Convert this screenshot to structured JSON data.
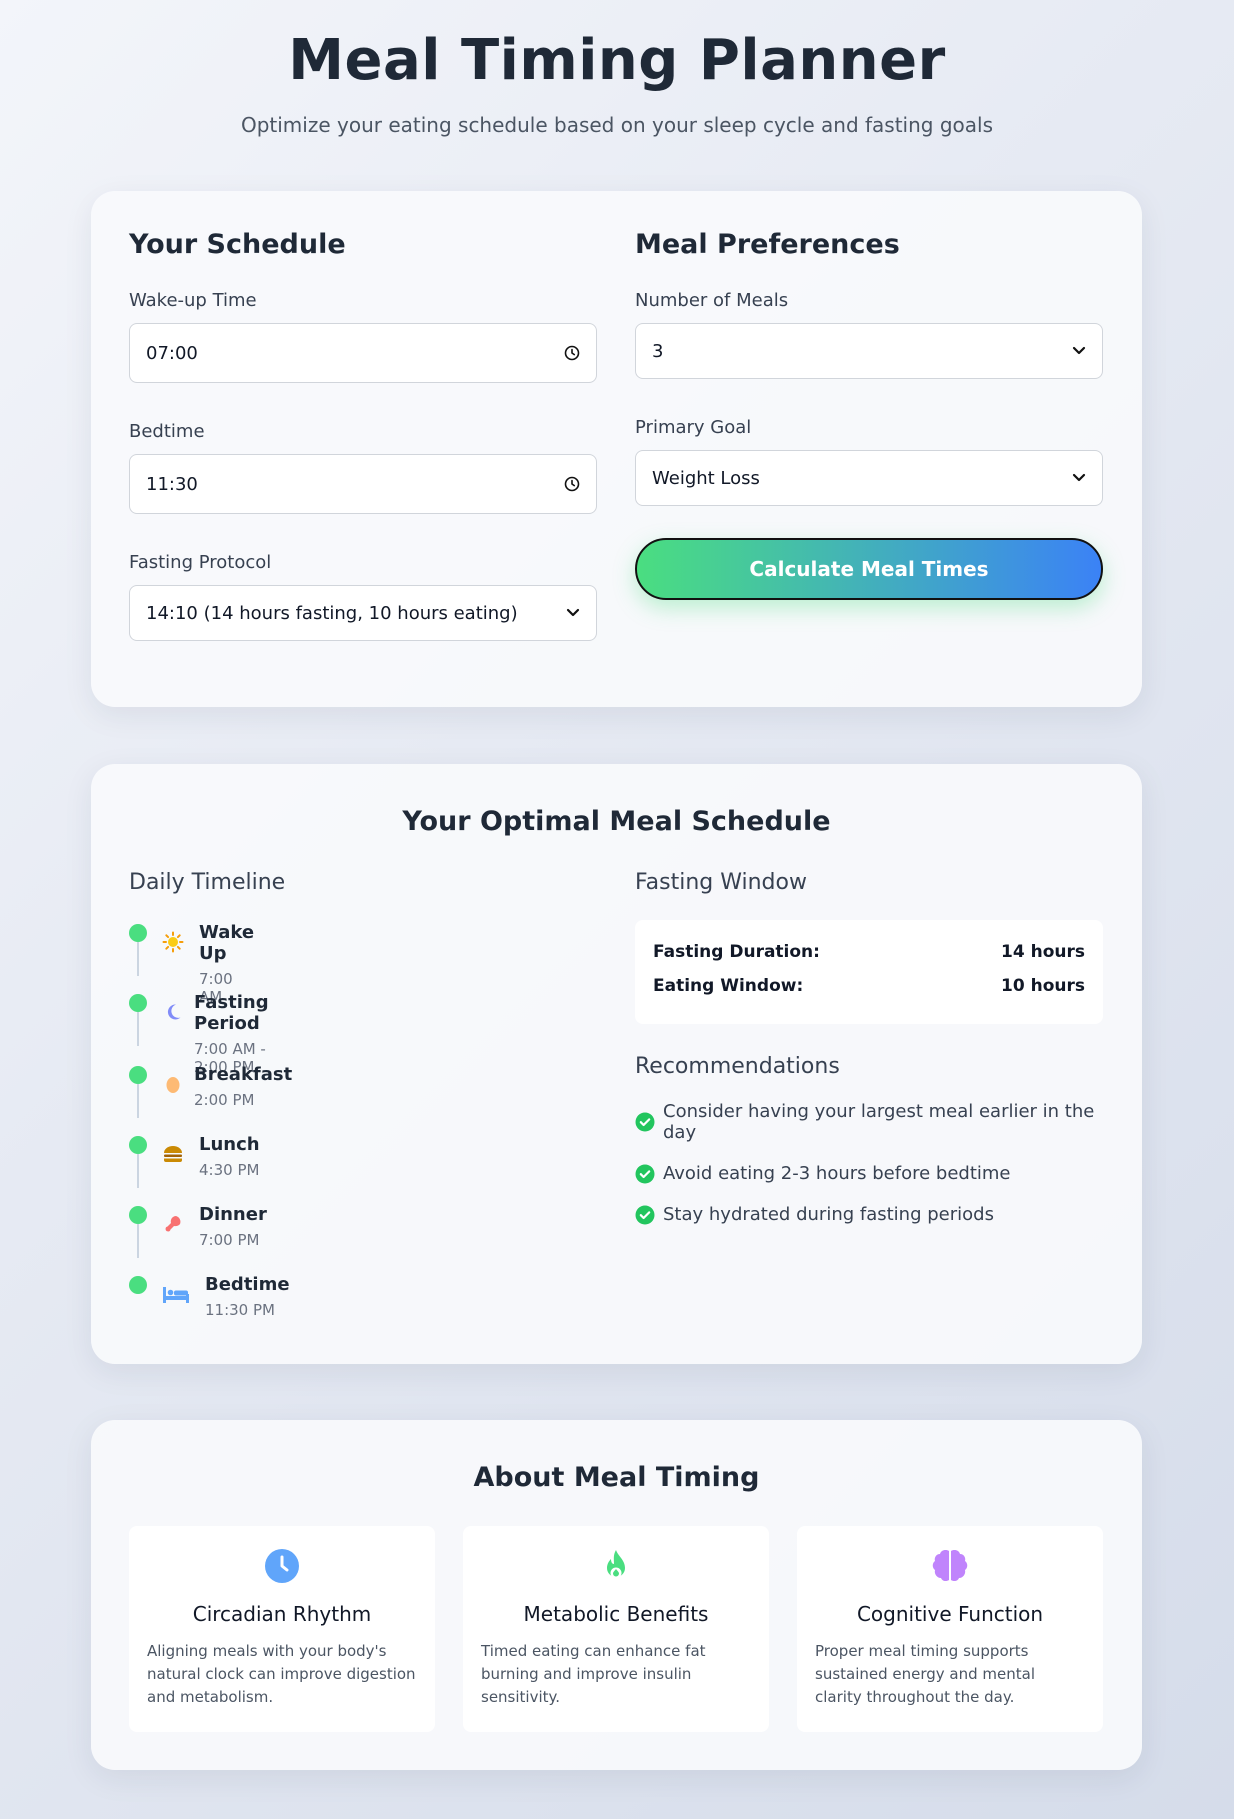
{
  "header": {
    "title": "Meal Timing Planner",
    "subtitle": "Optimize your eating schedule based on your sleep cycle and fasting goals"
  },
  "schedule_form": {
    "title": "Your Schedule",
    "wake_label": "Wake-up Time",
    "wake_value": "07:00",
    "bed_label": "Bedtime",
    "bed_value": "11:30",
    "protocol_label": "Fasting Protocol",
    "protocol_value": "14:10 (14 hours fasting, 10 hours eating)"
  },
  "preferences": {
    "title": "Meal Preferences",
    "meals_label": "Number of Meals",
    "meals_value": "3",
    "goal_label": "Primary Goal",
    "goal_value": "Weight Loss",
    "calc_button": "Calculate Meal Times"
  },
  "results": {
    "title": "Your Optimal Meal Schedule",
    "timeline_title": "Daily Timeline",
    "timeline": [
      {
        "label": "Wake Up",
        "time": "7:00 AM",
        "icon": "sun-icon"
      },
      {
        "label": "Fasting Period",
        "time": "7:00 AM - 2:00 PM",
        "icon": "moon-icon"
      },
      {
        "label": "Breakfast",
        "time": "2:00 PM",
        "icon": "egg-icon"
      },
      {
        "label": "Lunch",
        "time": "4:30 PM",
        "icon": "burger-icon"
      },
      {
        "label": "Dinner",
        "time": "7:00 PM",
        "icon": "drumstick-icon"
      },
      {
        "label": "Bedtime",
        "time": "11:30 PM",
        "icon": "bed-icon"
      }
    ],
    "fasting_title": "Fasting Window",
    "fasting_duration_label": "Fasting Duration:",
    "fasting_duration_value": "14 hours",
    "eating_window_label": "Eating Window:",
    "eating_window_value": "10 hours",
    "rec_title": "Recommendations",
    "recommendations": [
      "Consider having your largest meal earlier in the day",
      "Avoid eating 2-3 hours before bedtime",
      "Stay hydrated during fasting periods"
    ]
  },
  "about": {
    "title": "About Meal Timing",
    "cards": [
      {
        "title": "Circadian Rhythm",
        "text": "Aligning meals with your body's natural clock can improve digestion and metabolism.",
        "icon": "clock-icon"
      },
      {
        "title": "Metabolic Benefits",
        "text": "Timed eating can enhance fat burning and improve insulin sensitivity.",
        "icon": "flame-icon"
      },
      {
        "title": "Cognitive Function",
        "text": "Proper meal timing supports sustained energy and mental clarity throughout the day.",
        "icon": "brain-icon"
      }
    ]
  },
  "colors": {
    "accent_green": "#4ade80",
    "accent_blue": "#3b82f6"
  }
}
